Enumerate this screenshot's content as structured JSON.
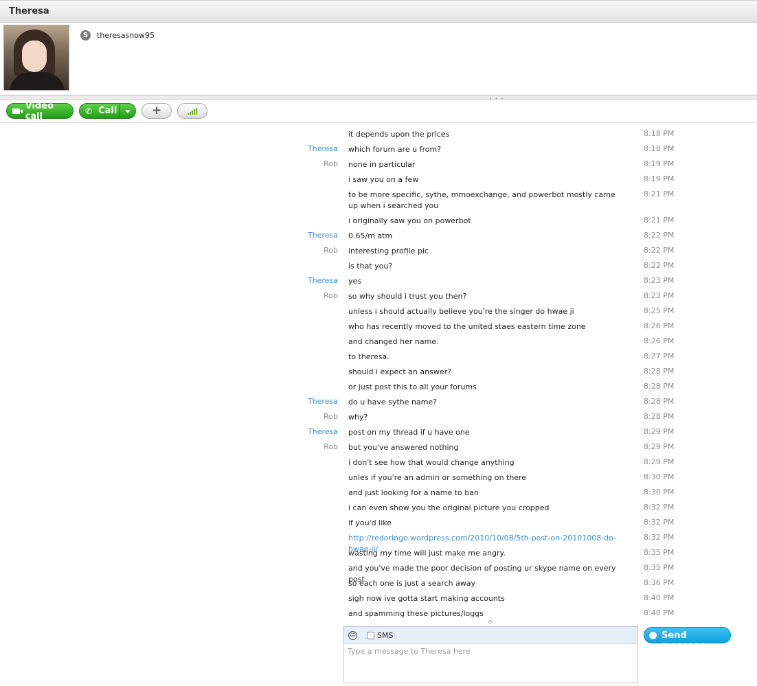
{
  "contact": {
    "display_name": "Theresa",
    "skype_name": "theresasnow95"
  },
  "toolbar": {
    "video_call_label": "Video call",
    "call_label": "Call",
    "add_label": "+"
  },
  "messages": [
    {
      "sender": "",
      "text": "it depends upon the prices",
      "time": "8:18 PM"
    },
    {
      "sender": "Theresa",
      "text": "which forum are u from?",
      "time": "8:18 PM"
    },
    {
      "sender": "Rob",
      "text": "none in particular",
      "time": "8:19 PM"
    },
    {
      "sender": "",
      "text": "i saw you on a few",
      "time": "8:19 PM"
    },
    {
      "sender": "",
      "text": "to be more specific, sythe, mmoexchange, and powerbot mostly came up when i searched you",
      "time": "8:21 PM"
    },
    {
      "sender": "",
      "text": "i originally saw you on powerbot",
      "time": "8:21 PM"
    },
    {
      "sender": "Theresa",
      "text": "0.65/m atm",
      "time": "8:22 PM"
    },
    {
      "sender": "Rob",
      "text": "interesting profile pic",
      "time": "8:22 PM"
    },
    {
      "sender": "",
      "text": "is that you?",
      "time": "8:22 PM"
    },
    {
      "sender": "Theresa",
      "text": "yes",
      "time": "8:23 PM"
    },
    {
      "sender": "Rob",
      "text": "so why should i trust you then?",
      "time": "8:23 PM"
    },
    {
      "sender": "",
      "text": "unless i should actually believe you're the singer do hwae ji",
      "time": "8:25 PM"
    },
    {
      "sender": "",
      "text": "who has recently moved to the united staes eastern time zone",
      "time": "8:26 PM"
    },
    {
      "sender": "",
      "text": "and changed her name.",
      "time": "8:26 PM"
    },
    {
      "sender": "",
      "text": "to theresa.",
      "time": "8:27 PM"
    },
    {
      "sender": "",
      "text": "should i expect an answer?",
      "time": "8:28 PM"
    },
    {
      "sender": "",
      "text": "or just post this to all your forums",
      "time": "8:28 PM"
    },
    {
      "sender": "Theresa",
      "text": "do u have sythe name?",
      "time": "8:28 PM"
    },
    {
      "sender": "Rob",
      "text": "why?",
      "time": "8:28 PM"
    },
    {
      "sender": "Theresa",
      "text": "post on my thread if u have one",
      "time": "8:29 PM"
    },
    {
      "sender": "Rob",
      "text": "but you've answered nothing",
      "time": "8:29 PM"
    },
    {
      "sender": "",
      "text": "i don't see how that would change anything",
      "time": "8:29 PM"
    },
    {
      "sender": "",
      "text": "unles if you're an admin or something on there",
      "time": "8:30 PM"
    },
    {
      "sender": "",
      "text": "and just looking for a name to ban",
      "time": "8:30 PM"
    },
    {
      "sender": "",
      "text": "i can even show you the original picture you cropped",
      "time": "8:32 PM"
    },
    {
      "sender": "",
      "text": "if you'd like",
      "time": "8:32 PM"
    },
    {
      "sender": "",
      "text": "http://redoringo.wordpress.com/2010/10/08/5th-post-on-20101008-do-hwae-ji/",
      "time": "8:32 PM",
      "is_link": true
    },
    {
      "sender": "",
      "text": "wasting my time will just make me angry.",
      "time": "8:35 PM"
    },
    {
      "sender": "",
      "text": "and you've made the poor decision of posting ur skype name on every post",
      "time": "8:35 PM"
    },
    {
      "sender": "",
      "text": "so each one is just a search away",
      "time": "8:36 PM"
    },
    {
      "sender": "",
      "text": "sigh now ive gotta start making accounts",
      "time": "8:40 PM"
    },
    {
      "sender": "",
      "text": "and spamming these pictures/loggs",
      "time": "8:40 PM"
    }
  ],
  "composer": {
    "sms_label": "SMS",
    "placeholder": "Type a message to Theresa here",
    "send_label": "Send message"
  },
  "colors": {
    "theresa": "#3b8fd0",
    "rob": "#8d8d8d",
    "call_green": "#239c17",
    "send_blue": "#0ea0dc"
  }
}
